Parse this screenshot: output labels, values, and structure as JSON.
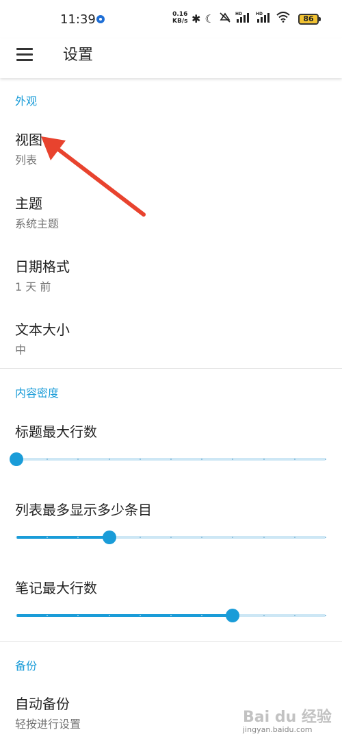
{
  "status_bar": {
    "time": "11:39",
    "net_speed_value": "0.16",
    "net_speed_unit": "KB/s",
    "battery": "86",
    "icons": [
      "bluetooth-icon",
      "moon-icon",
      "mute-icon",
      "hd-signal-icon",
      "hd-signal-icon",
      "wifi-icon",
      "battery-icon"
    ]
  },
  "appbar": {
    "title": "设置"
  },
  "appearance": {
    "header": "外观",
    "items": [
      {
        "title": "视图",
        "summary": "列表"
      },
      {
        "title": "主题",
        "summary": "系统主题"
      },
      {
        "title": "日期格式",
        "summary": "1 天 前"
      },
      {
        "title": "文本大小",
        "summary": "中"
      }
    ]
  },
  "density": {
    "header": "内容密度",
    "sliders": [
      {
        "title": "标题最大行数",
        "value": 0,
        "steps": 10
      },
      {
        "title": "列表最多显示多少条目",
        "value": 3,
        "steps": 10
      },
      {
        "title": "笔记最大行数",
        "value": 7,
        "steps": 10
      }
    ]
  },
  "backup": {
    "header": "备份",
    "items": [
      {
        "title": "自动备份",
        "summary": "轻按进行设置"
      }
    ]
  },
  "watermark": {
    "text": "Bai du 经验",
    "url": "jingyan.baidu.com"
  },
  "colors": {
    "accent": "#1a9cd8",
    "arrow": "#e8432e",
    "battery": "#f1c232"
  }
}
